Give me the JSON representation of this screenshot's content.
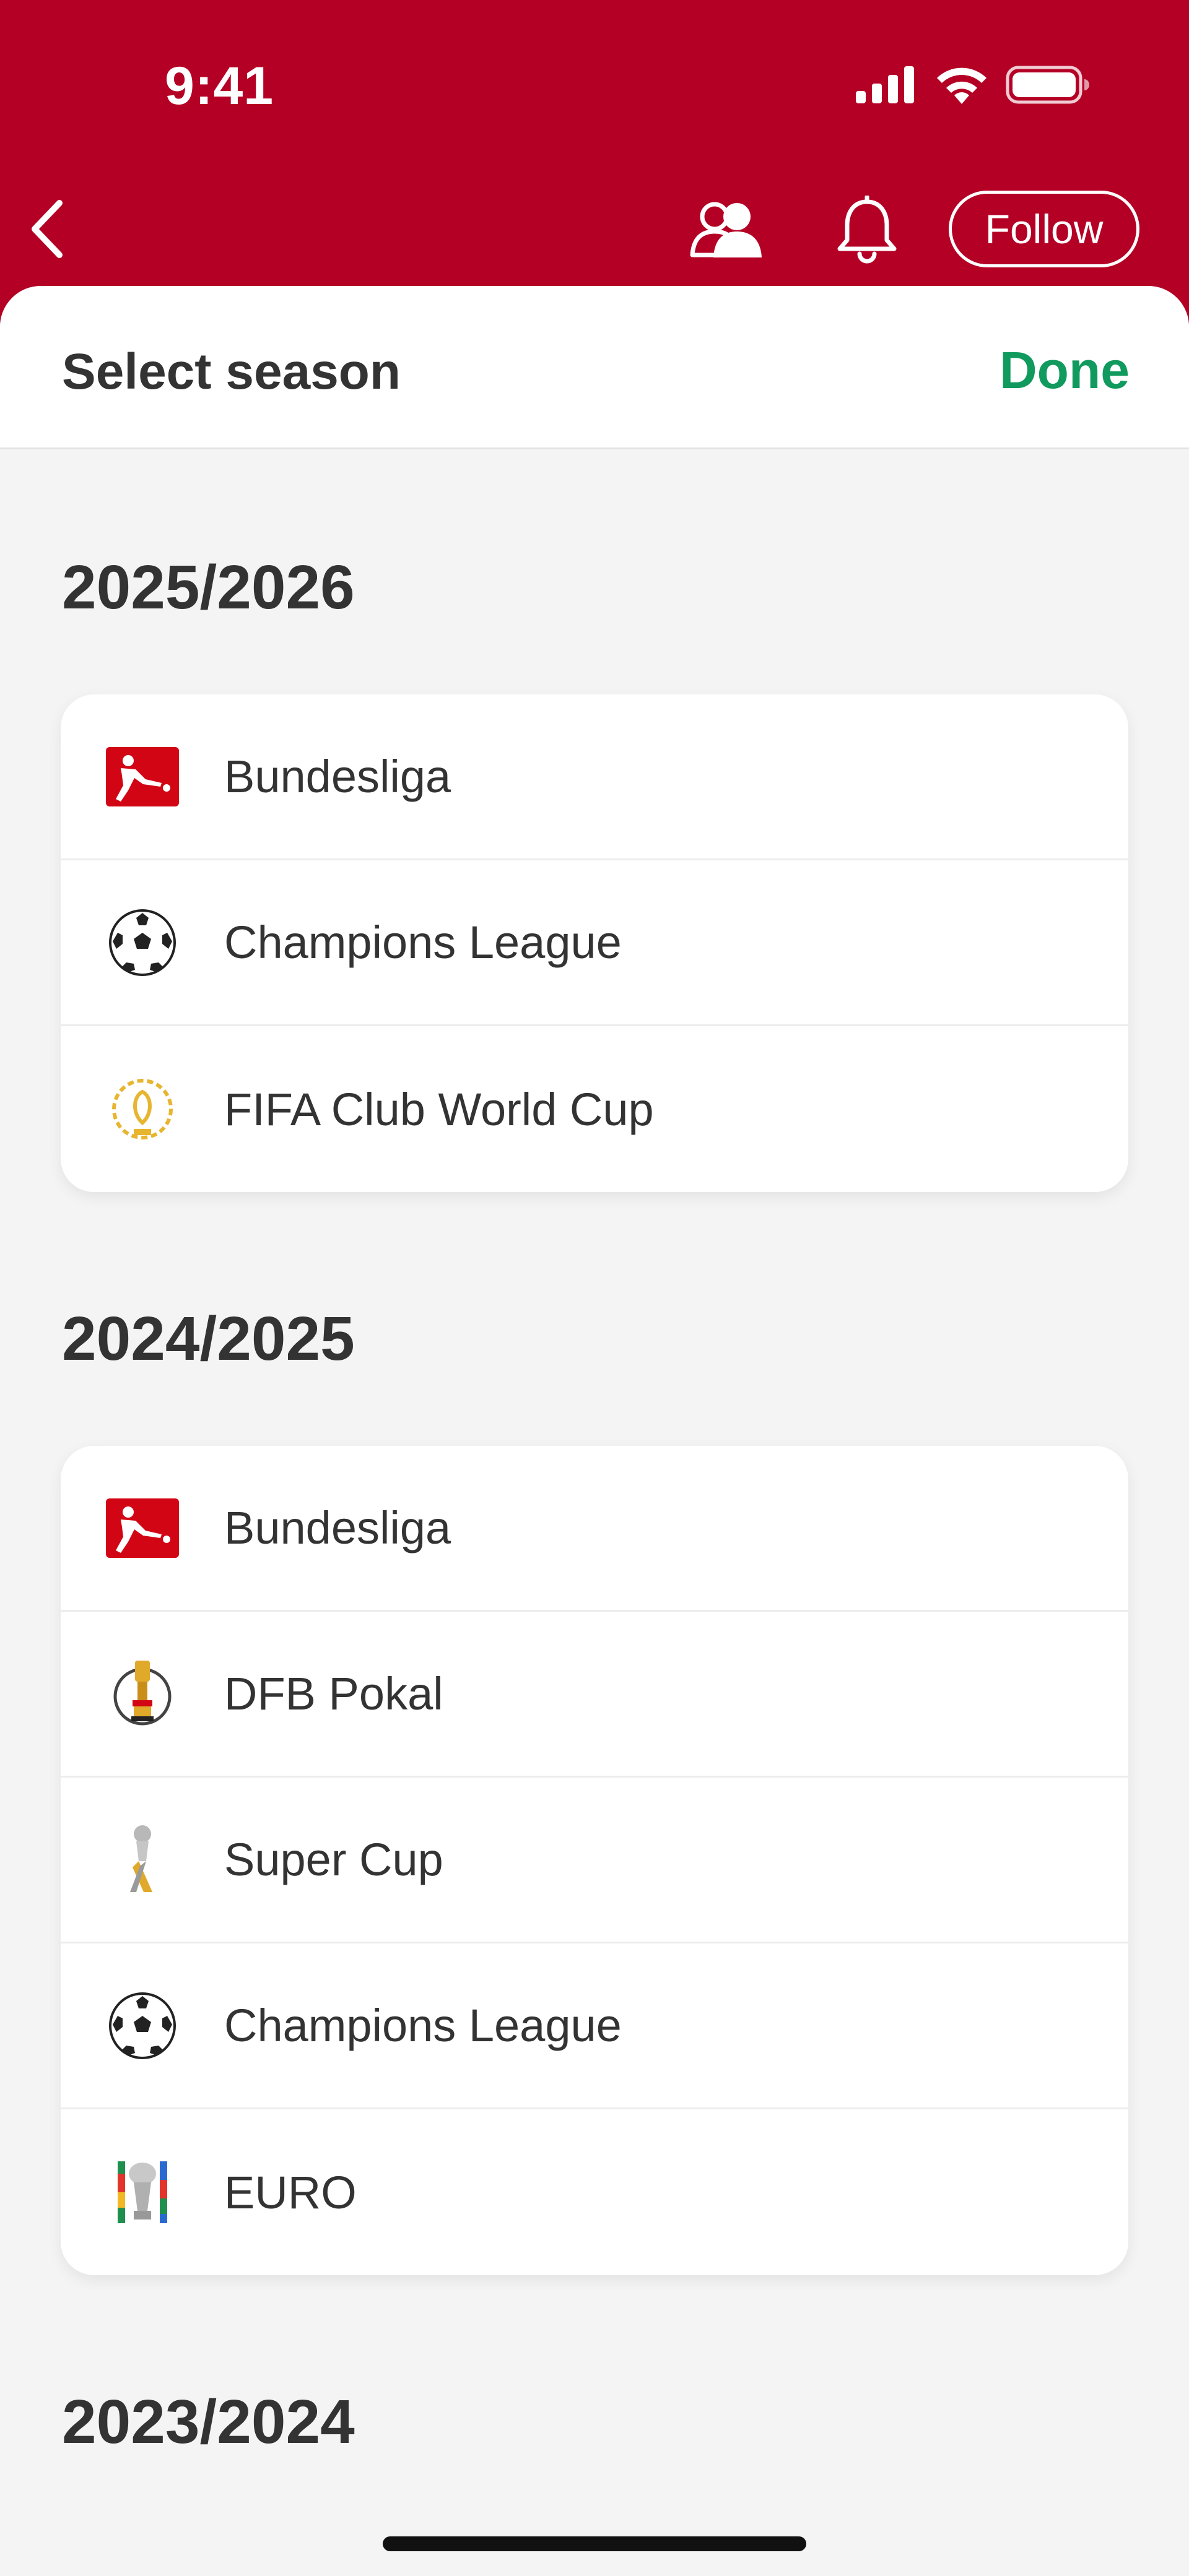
{
  "status_bar": {
    "time": "9:41"
  },
  "nav": {
    "follow_label": "Follow"
  },
  "sheet": {
    "title": "Select season",
    "done_label": "Done"
  },
  "seasons": [
    {
      "label": "2025/2026",
      "competitions": [
        {
          "name": "Bundesliga",
          "icon": "bundesliga-icon"
        },
        {
          "name": "Champions League",
          "icon": "champions-league-ball-icon"
        },
        {
          "name": "FIFA Club World Cup",
          "icon": "club-world-cup-icon"
        }
      ]
    },
    {
      "label": "2024/2025",
      "competitions": [
        {
          "name": "Bundesliga",
          "icon": "bundesliga-icon"
        },
        {
          "name": "DFB Pokal",
          "icon": "dfb-pokal-icon"
        },
        {
          "name": "Super Cup",
          "icon": "super-cup-icon"
        },
        {
          "name": "Champions League",
          "icon": "champions-league-ball-icon"
        },
        {
          "name": "EURO",
          "icon": "euro-trophy-icon"
        }
      ]
    },
    {
      "label": "2023/2024",
      "competitions": []
    }
  ],
  "colors": {
    "brand": "#b40025",
    "accent": "#119a5e",
    "text": "#333333",
    "sheet_bg": "#f4f4f4"
  }
}
